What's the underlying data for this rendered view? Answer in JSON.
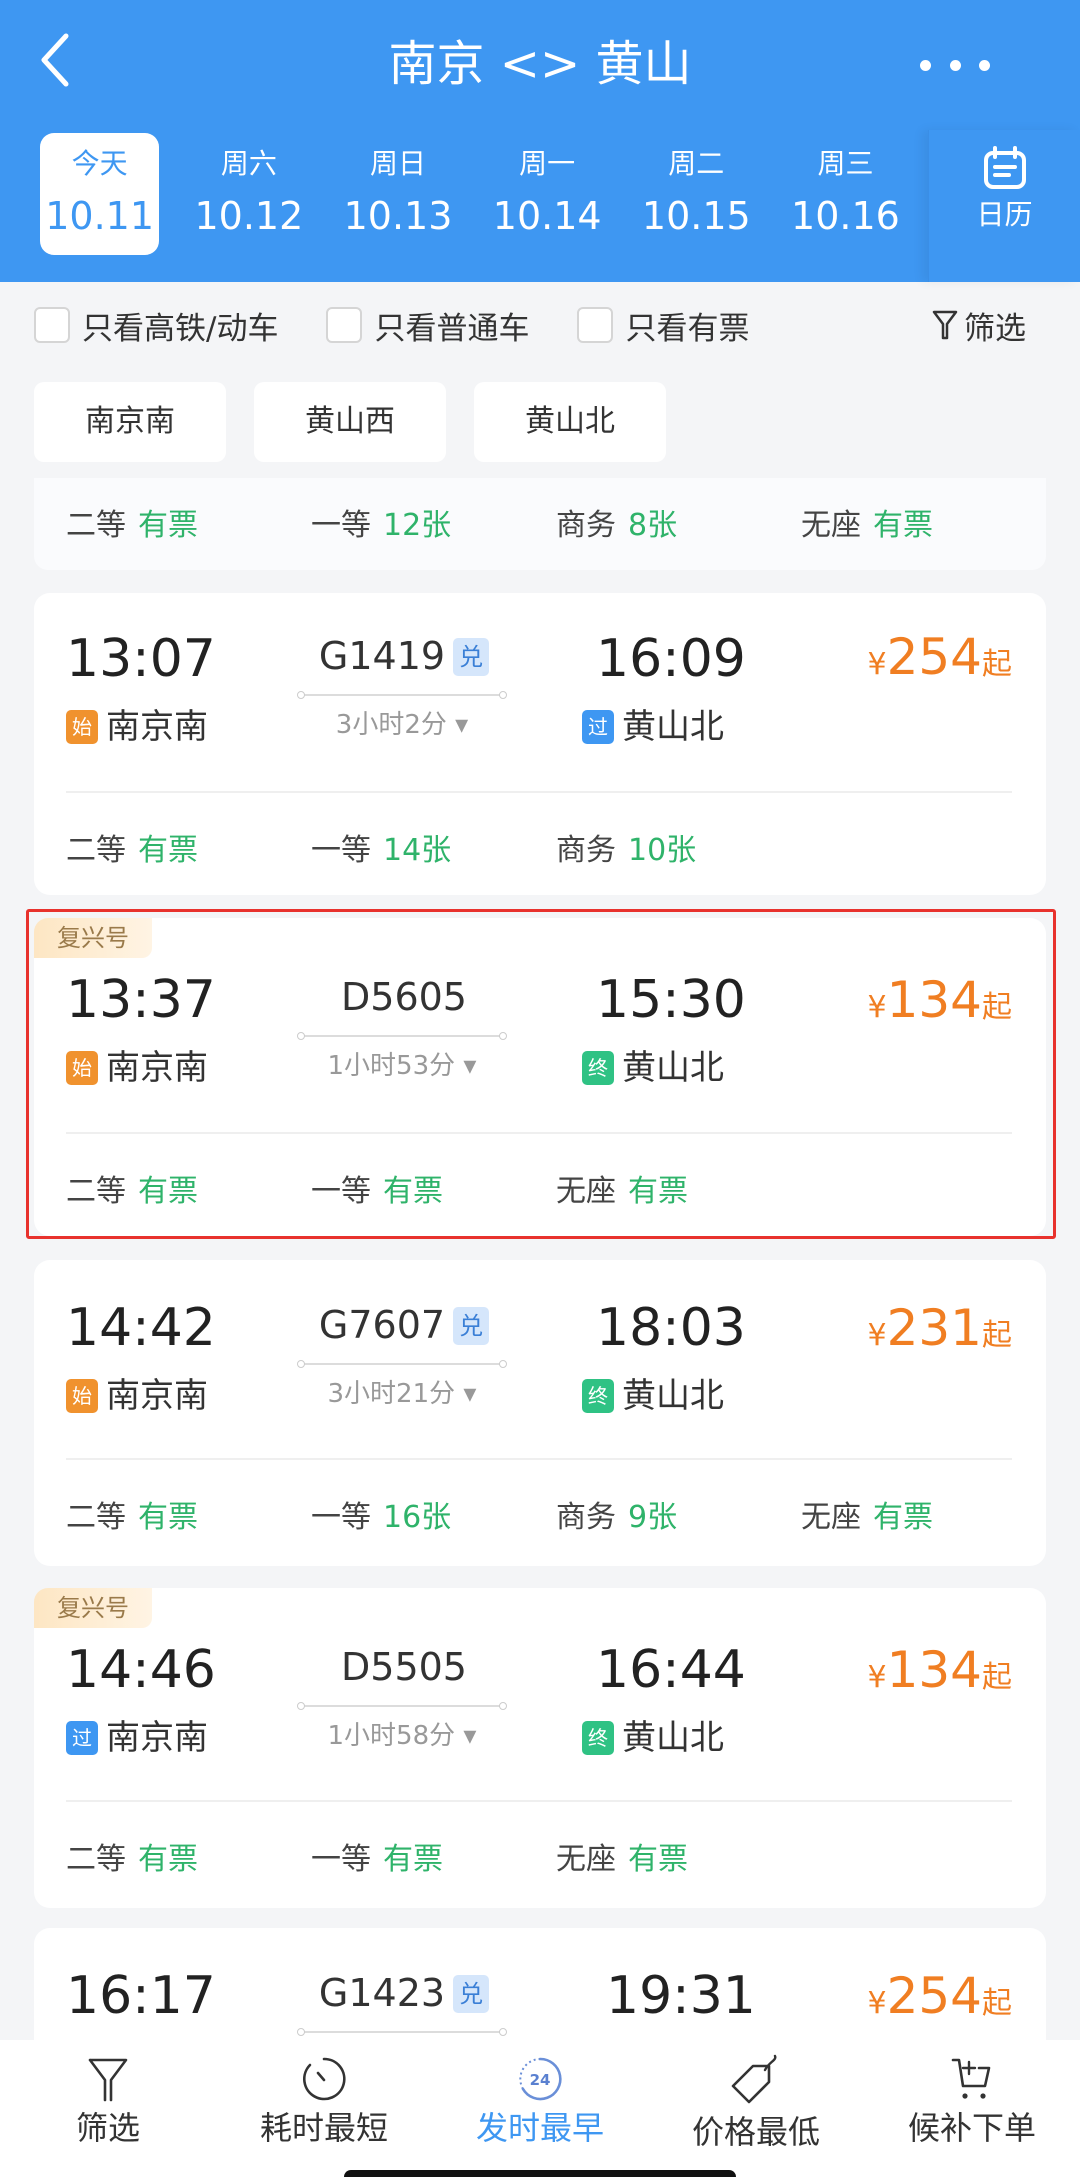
{
  "header": {
    "title": "南京 <> 黄山",
    "back_icon": "chevron-left-icon",
    "more_icon": "more-dots-icon",
    "dates": [
      {
        "weekday": "今天",
        "date": "10.11",
        "active": true
      },
      {
        "weekday": "周六",
        "date": "10.12"
      },
      {
        "weekday": "周日",
        "date": "10.13"
      },
      {
        "weekday": "周一",
        "date": "10.14"
      },
      {
        "weekday": "周二",
        "date": "10.15"
      },
      {
        "weekday": "周三",
        "date": "10.16"
      }
    ],
    "calendar_label": "日历"
  },
  "filters": {
    "high_speed_only": "只看高铁/动车",
    "regular_only": "只看普通车",
    "available_only": "只看有票",
    "filter_label": "筛选"
  },
  "stations": [
    "南京南",
    "黄山西",
    "黄山北"
  ],
  "partial_card": {
    "seats": [
      {
        "class": "二等",
        "avail": "有票"
      },
      {
        "class": "一等",
        "avail": "12张"
      },
      {
        "class": "商务",
        "avail": "8张"
      },
      {
        "class": "无座",
        "avail": "有票"
      }
    ]
  },
  "trains": [
    {
      "dep_time": "13:07",
      "train_no": "G1419",
      "exchange_badge": "兑",
      "arr_time": "16:09",
      "duration": "3小时2分",
      "from_tag": "始",
      "from": "南京南",
      "to_tag": "过",
      "to": "黄山北",
      "price_symbol": "¥",
      "price": "254",
      "price_suffix": "起",
      "seats": [
        {
          "class": "二等",
          "avail": "有票"
        },
        {
          "class": "一等",
          "avail": "14张"
        },
        {
          "class": "商务",
          "avail": "10张"
        }
      ]
    },
    {
      "badge": "复兴号",
      "dep_time": "13:37",
      "train_no": "D5605",
      "arr_time": "15:30",
      "duration": "1小时53分",
      "from_tag": "始",
      "from": "南京南",
      "to_tag": "终",
      "to": "黄山北",
      "price_symbol": "¥",
      "price": "134",
      "price_suffix": "起",
      "seats": [
        {
          "class": "二等",
          "avail": "有票"
        },
        {
          "class": "一等",
          "avail": "有票"
        },
        {
          "class": "无座",
          "avail": "有票"
        }
      ]
    },
    {
      "dep_time": "14:42",
      "train_no": "G7607",
      "exchange_badge": "兑",
      "arr_time": "18:03",
      "duration": "3小时21分",
      "from_tag": "始",
      "from": "南京南",
      "to_tag": "终",
      "to": "黄山北",
      "price_symbol": "¥",
      "price": "231",
      "price_suffix": "起",
      "seats": [
        {
          "class": "二等",
          "avail": "有票"
        },
        {
          "class": "一等",
          "avail": "16张"
        },
        {
          "class": "商务",
          "avail": "9张"
        },
        {
          "class": "无座",
          "avail": "有票"
        }
      ]
    },
    {
      "badge": "复兴号",
      "dep_time": "14:46",
      "train_no": "D5505",
      "arr_time": "16:44",
      "duration": "1小时58分",
      "from_tag": "过",
      "from": "南京南",
      "to_tag": "终",
      "to": "黄山北",
      "price_symbol": "¥",
      "price": "134",
      "price_suffix": "起",
      "seats": [
        {
          "class": "二等",
          "avail": "有票"
        },
        {
          "class": "一等",
          "avail": "有票"
        },
        {
          "class": "无座",
          "avail": "有票"
        }
      ]
    },
    {
      "dep_time": "16:17",
      "train_no": "G1423",
      "exchange_badge": "兑",
      "arr_time": "19:31",
      "price_symbol": "¥",
      "price": "254",
      "price_suffix": "起"
    }
  ],
  "tabbar": [
    {
      "label": "筛选",
      "icon": "filter-icon"
    },
    {
      "label": "耗时最短",
      "icon": "timer-icon"
    },
    {
      "label": "发时最早",
      "icon": "clock-24-icon",
      "active": true,
      "icon_text": "24"
    },
    {
      "label": "价格最低",
      "icon": "price-tag-icon"
    },
    {
      "label": "候补下单",
      "icon": "cart-add-icon"
    }
  ],
  "colors": {
    "brand_blue": "#3e97f2",
    "price_orange": "#f07e22",
    "available_green": "#2fb36a",
    "highlight_red": "#e8322d"
  }
}
